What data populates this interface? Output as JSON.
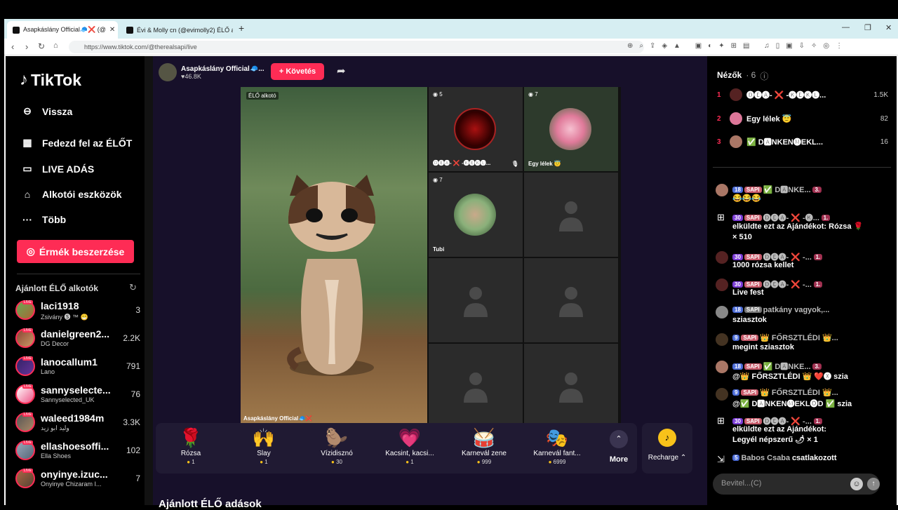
{
  "browser": {
    "tabs": [
      {
        "title": "Asapkáslány Official🧢❌ (@",
        "active": true
      },
      {
        "title": "Évi & Molly cn (@evimolly2) ÉLŐ adá",
        "active": false
      }
    ],
    "url": "https://www.tiktok.com/@therealsapi/live"
  },
  "sidebar": {
    "logo": "TikTok",
    "items": [
      {
        "label": "Vissza",
        "icon": "back-arrow-icon"
      },
      {
        "label": "Fedezd fel az ÉLŐT",
        "icon": "explore-icon"
      },
      {
        "label": "LIVE ADÁS",
        "icon": "camera-icon"
      },
      {
        "label": "Alkotói eszközök",
        "icon": "creator-tools-icon"
      },
      {
        "label": "Több",
        "icon": "more-icon"
      }
    ],
    "coins_button": "Érmék beszerzése",
    "recommended_header": "Ajánlott ÉLŐ alkotók",
    "creators": [
      {
        "name": "laci1918",
        "sub": "Zsivány 🅢 ™ 😁",
        "viewers": "3"
      },
      {
        "name": "danielgreen2...",
        "sub": "DG Decor",
        "viewers": "2.2K"
      },
      {
        "name": "lanocallum1",
        "sub": "Lano",
        "viewers": "791"
      },
      {
        "name": "sannyselecte...",
        "sub": "Sannyselected_UK",
        "viewers": "76"
      },
      {
        "name": "waleed1984m",
        "sub": "وليد ابو زيد",
        "viewers": "3.3K"
      },
      {
        "name": "ellashoesoffi...",
        "sub": "Ella Shoes",
        "viewers": "102"
      },
      {
        "name": "onyinye.izuc...",
        "sub": "Onyinye Chizaram I...",
        "viewers": "7"
      }
    ]
  },
  "main": {
    "host_name": "Asapkáslány Official🧢...",
    "host_likes": "♥46.8K",
    "follow": "+ Követés",
    "live_tag": "ÉLŐ alkotó",
    "host_video_name": "Asapkáslány Official🧢❌",
    "guests": [
      {
        "count": "5",
        "name": "🅓🅔🅐- ❌ -🅚🅔🅚🅛..."
      },
      {
        "count": "7",
        "name": "Egy lélek 😇"
      },
      {
        "count": "7",
        "name": "Tubi"
      }
    ],
    "gifts": [
      {
        "icon": "🌹",
        "name": "Rózsa",
        "price": "1"
      },
      {
        "icon": "🙌",
        "name": "Slay",
        "price": "1"
      },
      {
        "icon": "🦫",
        "name": "Vízidisznó",
        "price": "30"
      },
      {
        "icon": "💗",
        "name": "Kacsint, kacsi...",
        "price": "1"
      },
      {
        "icon": "🥁",
        "name": "Karnevál zene",
        "price": "999"
      },
      {
        "icon": "🎭",
        "name": "Karnevál fant...",
        "price": "6999"
      }
    ],
    "more": "More",
    "recharge": "Recharge ⌃",
    "recommended_lives": "Ajánlott ÉLŐ adások"
  },
  "chat": {
    "viewers_title": "Nézők",
    "viewers_count": "· 6",
    "top_viewers": [
      {
        "rank": "1",
        "name": "🅓🅔🅐- ❌ -🅚🅔🅚🅛...",
        "score": "1.5K"
      },
      {
        "rank": "2",
        "name": "Egy lélek 😇",
        "score": "82"
      },
      {
        "rank": "3",
        "name": "✅ D🅰NKEN🅜EKL...",
        "score": "16"
      }
    ],
    "messages": [
      {
        "type": "user",
        "lv": "18",
        "b2": "SAPI",
        "user": "✅ D🅰NKE...",
        "fan": "3.",
        "text": "😂😂😂"
      },
      {
        "type": "gift",
        "lv": "30",
        "b2": "SAPI",
        "user": "🅓🅔🅐- ❌ -🅚...",
        "fan": "1.",
        "text": "elküldte ezt az Ajándékot: Rózsa 🌹",
        "text2": "× 510"
      },
      {
        "type": "user",
        "lv": "30",
        "b2": "SAPI",
        "user": "🅓🅔🅐- ❌ -...",
        "fan": "1.",
        "text": "1000 rózsa kellet"
      },
      {
        "type": "user",
        "lv": "30",
        "b2": "SAPI",
        "user": "🅓🅔🅐- ❌ -...",
        "fan": "1.",
        "text": "Live fest"
      },
      {
        "type": "user",
        "lv": "18",
        "b2": "SAPI",
        "user": "patkány vagyok,...",
        "fan": "",
        "text": "sziasztok"
      },
      {
        "type": "user",
        "lv": "9",
        "b2": "SAPI",
        "user": "👑 FŐRSZTLÉDI 👑...",
        "fan": "",
        "text": "megint sziasztok"
      },
      {
        "type": "user",
        "lv": "18",
        "b2": "SAPI",
        "user": "✅ D🅰NKE...",
        "fan": "3.",
        "text": "@👑 FŐRSZTLÉDI 👑 ❤️🅧 szia"
      },
      {
        "type": "user",
        "lv": "9",
        "b2": "SAPI",
        "user": "👑 FŐRSZTLÉDI 👑...",
        "fan": "",
        "text": "@✅ D🅰NKEN🅜EKL🅞D ✅ szia"
      },
      {
        "type": "gift",
        "lv": "30",
        "b2": "SAPI",
        "user": "🅓🅔🅐- ❌ -...",
        "fan": "1.",
        "text": "elküldte ezt az Ajándékot:",
        "text2": "Legyél népszerű 🌶 × 1"
      }
    ],
    "joined": {
      "lv": "5",
      "user": "Babos Csaba",
      "text": "csatlakozott"
    },
    "input_placeholder": "Bevitel...(C)"
  }
}
